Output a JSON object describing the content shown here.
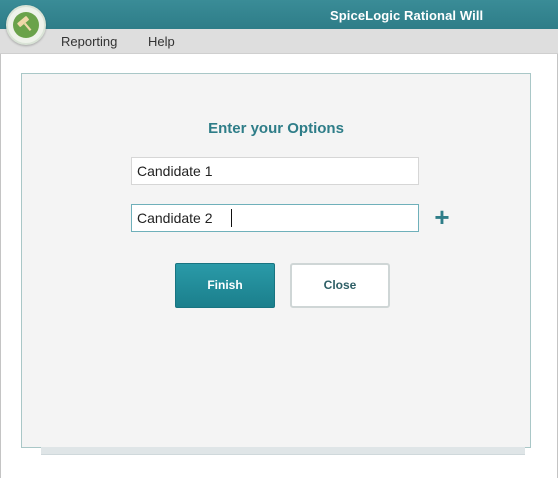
{
  "window": {
    "title": "SpiceLogic Rational Will"
  },
  "menu": {
    "items": [
      {
        "label": "Reporting"
      },
      {
        "label": "Help"
      }
    ]
  },
  "dialog": {
    "heading": "Enter your Options",
    "options": [
      {
        "value": "Candidate 1",
        "focused": false
      },
      {
        "value": "Candidate 2",
        "focused": true
      }
    ],
    "add_icon": "plus-icon",
    "add_glyph": "+",
    "finish_label": "Finish",
    "close_label": "Close"
  },
  "colors": {
    "accent": "#2e7d88",
    "titlebar": "#2e7d88",
    "finish_button": "#1b7f8c",
    "panel_background": "#f4f4f4",
    "logo_green": "#6aa24a"
  }
}
